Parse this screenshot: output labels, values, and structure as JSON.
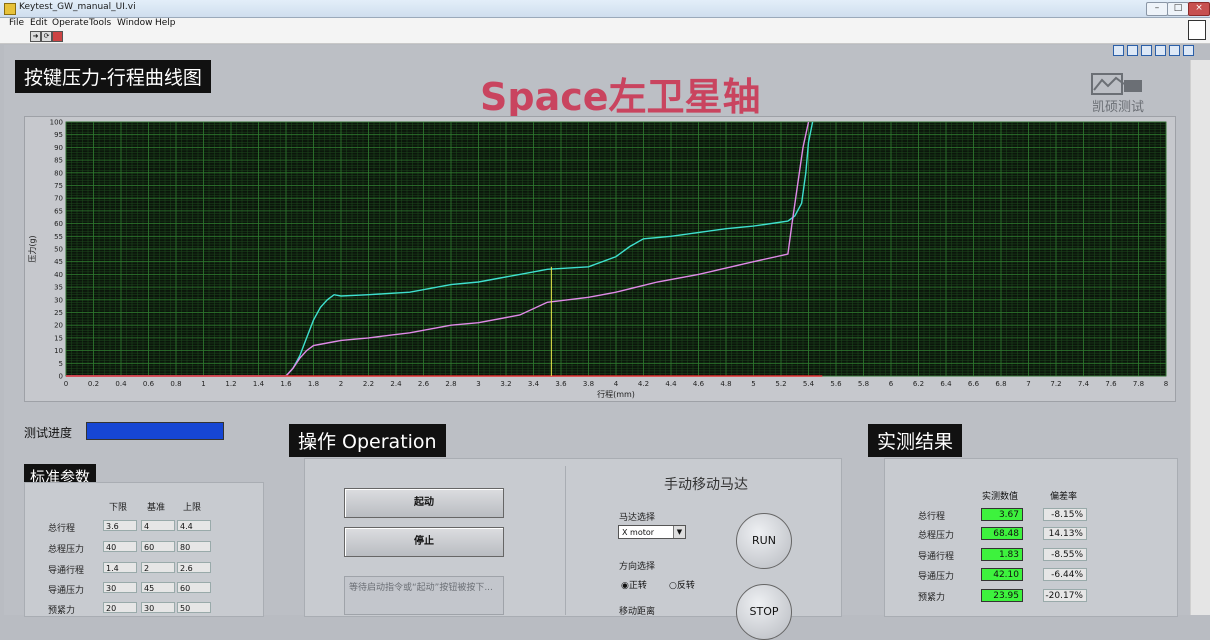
{
  "window": {
    "title": "Keytest_GW_manual_UI.vi"
  },
  "menu": [
    "File",
    "Edit",
    "Operate",
    "Tools",
    "Window",
    "Help"
  ],
  "chart_section_label": "按键压力-行程曲线图",
  "big_title": "Space左卫星轴",
  "logo_text": "凯硕测试",
  "chart_data": {
    "type": "line",
    "xlabel": "行程(mm)",
    "ylabel": "压力(g)",
    "xlim": [
      0,
      8
    ],
    "ylim": [
      0,
      100
    ],
    "x_ticks": [
      "0",
      "0.2",
      "0.4",
      "0.6",
      "0.8",
      "1",
      "1.2",
      "1.4",
      "1.6",
      "1.8",
      "2",
      "2.2",
      "2.4",
      "2.6",
      "2.8",
      "3",
      "3.2",
      "3.4",
      "3.6",
      "3.8",
      "4",
      "4.2",
      "4.4",
      "4.6",
      "4.8",
      "5",
      "5.2",
      "5.4",
      "5.6",
      "5.8",
      "6",
      "6.2",
      "6.4",
      "6.6",
      "6.8",
      "7",
      "7.2",
      "7.4",
      "7.6",
      "7.8",
      "8"
    ],
    "y_ticks": [
      "0",
      "5",
      "10",
      "15",
      "20",
      "25",
      "30",
      "35",
      "40",
      "45",
      "50",
      "55",
      "60",
      "65",
      "70",
      "75",
      "80",
      "85",
      "90",
      "95",
      "100"
    ],
    "grid": true,
    "background": "#0b160b",
    "cursor_x": 3.53,
    "series": [
      {
        "color": "#3fe0cf",
        "x": [
          0,
          1.6,
          1.65,
          1.7,
          1.75,
          1.8,
          1.85,
          1.9,
          1.95,
          2.0,
          2.2,
          2.5,
          2.8,
          3.0,
          3.3,
          3.5,
          3.8,
          4.0,
          4.1,
          4.2,
          4.4,
          4.8,
          5.0,
          5.25,
          5.3,
          5.35,
          5.38,
          5.4,
          5.43
        ],
        "y": [
          0,
          0,
          3,
          8,
          15,
          22,
          27,
          30,
          32,
          31.5,
          32,
          33,
          36,
          37,
          40,
          42,
          43,
          47,
          51,
          54,
          55,
          58,
          59,
          61,
          63,
          68,
          80,
          92,
          100
        ]
      },
      {
        "color": "#e08ae8",
        "x": [
          0,
          1.6,
          1.65,
          1.7,
          1.75,
          1.8,
          1.9,
          2.0,
          2.2,
          2.5,
          2.8,
          3.0,
          3.3,
          3.5,
          3.8,
          4.0,
          4.3,
          4.6,
          5.0,
          5.25,
          5.28,
          5.32,
          5.36,
          5.4
        ],
        "y": [
          0,
          0,
          3,
          7,
          10,
          12,
          13,
          14,
          15,
          17,
          20,
          21,
          24,
          29,
          31,
          33,
          37,
          40,
          45,
          48,
          60,
          75,
          90,
          100
        ]
      },
      {
        "color": "#e03030",
        "x": [
          0,
          5.5
        ],
        "y": [
          0,
          0
        ]
      }
    ]
  },
  "progress": {
    "label": "测试进度",
    "value": 1.0
  },
  "params": {
    "label": "标准参数",
    "headers": [
      "下限",
      "基准",
      "上限"
    ],
    "rows": [
      {
        "name": "总行程",
        "values": [
          "3.6",
          "4",
          "4.4"
        ]
      },
      {
        "name": "总程压力",
        "values": [
          "40",
          "60",
          "80"
        ]
      },
      {
        "name": "导通行程",
        "values": [
          "1.4",
          "2",
          "2.6"
        ]
      },
      {
        "name": "导通压力",
        "values": [
          "30",
          "45",
          "60"
        ]
      },
      {
        "name": "预紧力",
        "values": [
          "20",
          "30",
          "50"
        ]
      }
    ]
  },
  "operation": {
    "label": "操作 Operation",
    "start_button": "起动",
    "stop_button": "停止",
    "message": "等待启动指令或“起动”按钮被按下...",
    "manual_title": "手动移动马达",
    "motor_select_label": "马达选择",
    "motor_selected": "X motor",
    "direction_label": "方向选择",
    "dir_forward": "正转",
    "dir_reverse": "反转",
    "distance_label": "移动距离",
    "run_button": "RUN",
    "stop_round_button": "STOP"
  },
  "results": {
    "label": "实测结果",
    "col_value": "实测数值",
    "col_dev": "偏差率",
    "rows": [
      {
        "name": "总行程",
        "value": "3.67",
        "dev": "-8.15%"
      },
      {
        "name": "总程压力",
        "value": "68.48",
        "dev": "14.13%"
      },
      {
        "name": "导通行程",
        "value": "1.83",
        "dev": "-8.55%"
      },
      {
        "name": "导通压力",
        "value": "42.10",
        "dev": "-6.44%"
      },
      {
        "name": "预紧力",
        "value": "23.95",
        "dev": "-20.17%"
      }
    ]
  }
}
